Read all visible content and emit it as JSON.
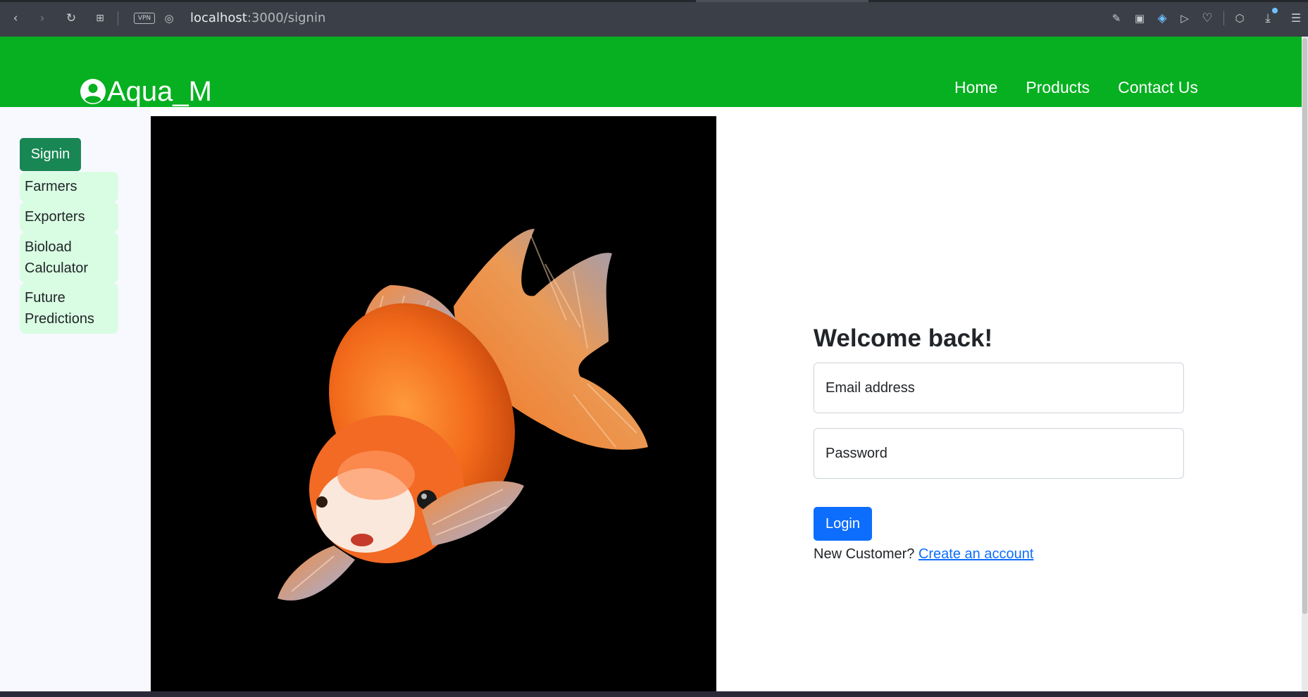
{
  "browser": {
    "url_host": "localhost",
    "url_path": ":3000/signin",
    "vpn_label": "VPN",
    "icons": [
      "back-icon",
      "forward-icon",
      "reload-icon",
      "tabs-grid-icon",
      "vpn-badge",
      "globe-icon",
      "share-icon",
      "camera-icon",
      "shield-icon",
      "send-icon",
      "heart-icon",
      "cube-icon",
      "download-icon",
      "settings-sliders-icon"
    ]
  },
  "navbar": {
    "brand": "Aqua_M",
    "links": [
      "Home",
      "Products",
      "Contact Us"
    ],
    "color": "#06b020"
  },
  "sidebar": {
    "signin": "Signin",
    "items": [
      "Farmers",
      "Exporters",
      "Bioload Calculator",
      "Future Predictions"
    ]
  },
  "login": {
    "heading": "Welcome back!",
    "email_placeholder": "Email address",
    "password_placeholder": "Password",
    "button": "Login",
    "new_customer": "New Customer?",
    "create_account": "Create an account",
    "button_color": "#0d6efd"
  }
}
